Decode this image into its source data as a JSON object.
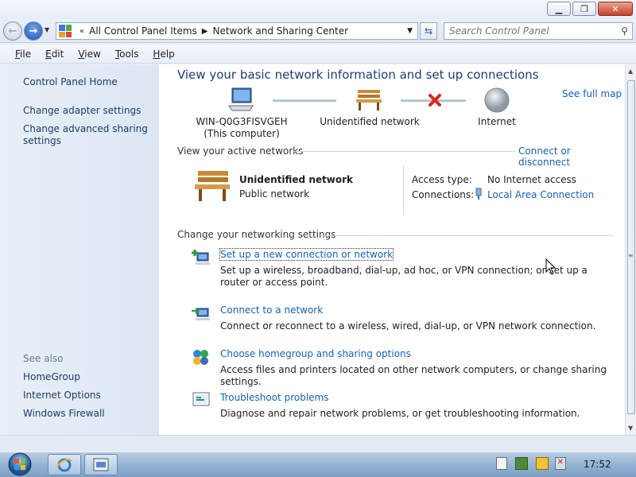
{
  "window": {
    "caption_buttons": [
      "minimize-icon",
      "maximize-icon",
      "close-icon"
    ]
  },
  "addressbar": {
    "overflow": "«",
    "crumbs": [
      "All Control Panel Items",
      "Network and Sharing Center"
    ],
    "search_placeholder": "Search Control Panel"
  },
  "menu": [
    "File",
    "Edit",
    "View",
    "Tools",
    "Help"
  ],
  "sidebar": {
    "home": "Control Panel Home",
    "links": [
      "Change adapter settings",
      "Change advanced sharing settings"
    ],
    "see_also_title": "See also",
    "see_also": [
      "HomeGroup",
      "Internet Options",
      "Windows Firewall"
    ]
  },
  "main": {
    "title": "View your basic network information and set up connections",
    "see_full_map": "See full map",
    "map": {
      "computer_name": "WIN-Q0G3FISVGEH",
      "computer_sub": "(This computer)",
      "network": "Unidentified network",
      "internet": "Internet"
    },
    "active": {
      "heading": "View your active networks",
      "connect_link": "Connect or disconnect",
      "network_name": "Unidentified network",
      "network_category": "Public network",
      "access_type_label": "Access type:",
      "access_type_value": "No Internet access",
      "connections_label": "Connections:",
      "connections_value": "Local Area Connection"
    },
    "settings": {
      "heading": "Change your networking settings",
      "tasks": [
        {
          "link": "Set up a new connection or network",
          "desc": "Set up a wireless, broadband, dial-up, ad hoc, or VPN connection; or set up a router or access point."
        },
        {
          "link": "Connect to a network",
          "desc": "Connect or reconnect to a wireless, wired, dial-up, or VPN network connection."
        },
        {
          "link": "Choose homegroup and sharing options",
          "desc": "Access files and printers located on other network computers, or change sharing settings."
        },
        {
          "link": "Troubleshoot problems",
          "desc": "Diagnose and repair network problems, or get troubleshooting information."
        }
      ]
    }
  },
  "taskbar": {
    "clock": "17:52"
  }
}
